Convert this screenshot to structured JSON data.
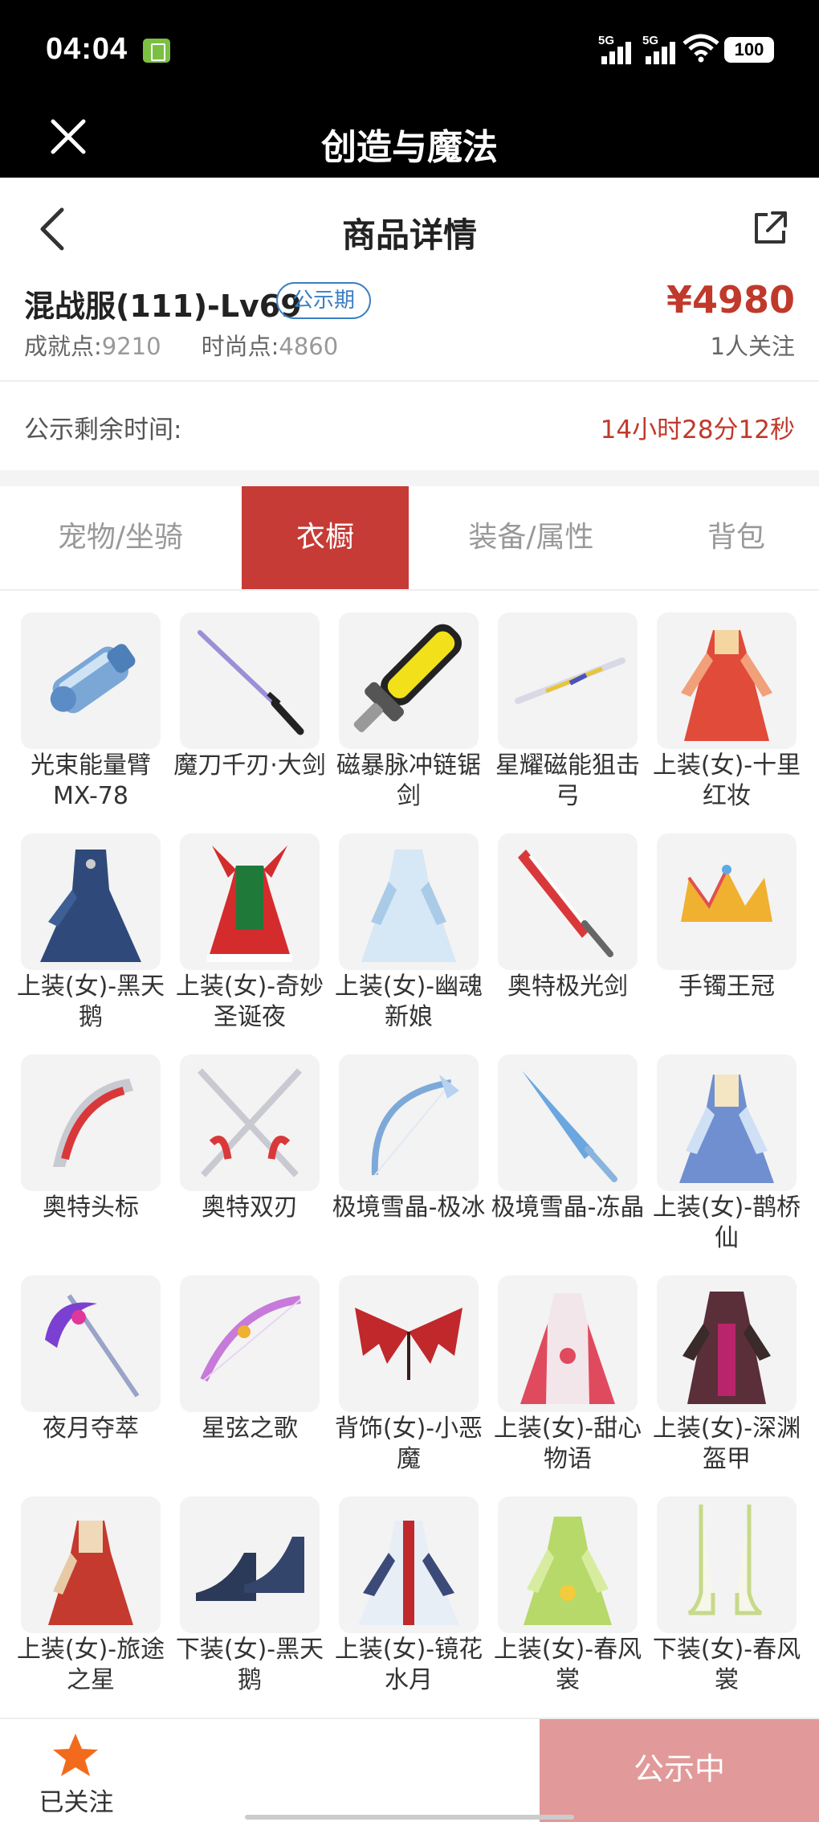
{
  "status": {
    "time": "04:04",
    "signal1": "5G",
    "signal2": "5G",
    "battery": "100"
  },
  "app": {
    "title": "创造与魔法"
  },
  "nav": {
    "title": "商品详情"
  },
  "product": {
    "name": "混战服(111)-Lv69",
    "badge": "公示期",
    "price": "¥4980",
    "achievement_label": "成就点:",
    "achievement_value": "9210",
    "fashion_label": "时尚点:",
    "fashion_value": "4860",
    "followers": "1人关注"
  },
  "countdown": {
    "label": "公示剩余时间:",
    "value": "14小时28分12秒"
  },
  "tabs": [
    "宠物/坐骑",
    "衣橱",
    "装备/属性",
    "背包"
  ],
  "active_tab": "衣橱",
  "colors": {
    "accent": "#c63b36",
    "price": "#c0392b",
    "badge": "#3a7fc4",
    "button_disabled": "#e19a99"
  },
  "items": [
    {
      "name": "光束能量臂MX-78",
      "icon": "arm-cannon-icon"
    },
    {
      "name": "魔刀千刃·大剑",
      "icon": "katana-icon"
    },
    {
      "name": "磁暴脉冲链锯剑",
      "icon": "chainsaw-sword-icon"
    },
    {
      "name": "星耀磁能狙击弓",
      "icon": "sniper-bow-icon"
    },
    {
      "name": "上装(女)-十里红妆",
      "icon": "red-dress-icon"
    },
    {
      "name": "上装(女)-黑天鹅",
      "icon": "black-swan-dress-icon"
    },
    {
      "name": "上装(女)-奇妙圣诞夜",
      "icon": "christmas-dress-icon"
    },
    {
      "name": "上装(女)-幽魂新娘",
      "icon": "ghost-bride-dress-icon"
    },
    {
      "name": "奥特极光剑",
      "icon": "ultra-sword-icon"
    },
    {
      "name": "手镯王冠",
      "icon": "crown-icon"
    },
    {
      "name": "奥特头标",
      "icon": "ultra-headpiece-icon"
    },
    {
      "name": "奥特双刃",
      "icon": "twin-blades-icon"
    },
    {
      "name": "极境雪晶-极冰",
      "icon": "ice-bow-icon"
    },
    {
      "name": "极境雪晶-冻晶",
      "icon": "ice-spear-icon"
    },
    {
      "name": "上装(女)-鹊桥仙",
      "icon": "fairy-dress-icon"
    },
    {
      "name": "夜月夺萃",
      "icon": "moon-scythe-icon"
    },
    {
      "name": "星弦之歌",
      "icon": "star-bow-icon"
    },
    {
      "name": "背饰(女)-小恶魔",
      "icon": "demon-wings-icon"
    },
    {
      "name": "上装(女)-甜心物语",
      "icon": "sweetheart-dress-icon"
    },
    {
      "name": "上装(女)-深渊盔甲",
      "icon": "abyss-armor-icon"
    },
    {
      "name": "上装(女)-旅途之星",
      "icon": "journey-dress-icon"
    },
    {
      "name": "下装(女)-黑天鹅",
      "icon": "high-heels-icon"
    },
    {
      "name": "上装(女)-镜花水月",
      "icon": "mirror-dress-icon"
    },
    {
      "name": "上装(女)-春风裳",
      "icon": "spring-dress-icon"
    },
    {
      "name": "下装(女)-春风裳",
      "icon": "spring-sandals-icon"
    }
  ],
  "bottom": {
    "follow_label": "已关注",
    "action_label": "公示中"
  }
}
